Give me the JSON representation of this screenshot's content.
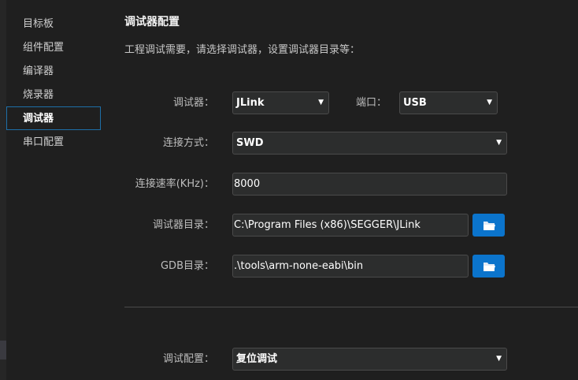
{
  "sidebar": {
    "items": [
      {
        "label": "目标板"
      },
      {
        "label": "组件配置"
      },
      {
        "label": "编译器"
      },
      {
        "label": "烧录器"
      },
      {
        "label": "调试器",
        "active": true
      },
      {
        "label": "串口配置"
      }
    ]
  },
  "header": {
    "title": "调试器配置",
    "description": "工程调试需要，请选择调试器，设置调试器目录等："
  },
  "form": {
    "debugger": {
      "label": "调试器：",
      "value": "JLink"
    },
    "port": {
      "label": "端口：",
      "value": "USB"
    },
    "connection": {
      "label": "连接方式：",
      "value": "SWD"
    },
    "speed": {
      "label": "连接速率(KHz)：",
      "value": "8000"
    },
    "debugger_dir": {
      "label": "调试器目录：",
      "value": "C:\\Program Files (x86)\\SEGGER\\JLink"
    },
    "gdb_dir": {
      "label": "GDB目录：",
      "value": ".\\tools\\arm-none-eabi\\bin"
    },
    "debug_config": {
      "label": "调试配置：",
      "value": "复位调试"
    }
  },
  "colors": {
    "accent": "#0b74cc",
    "selection_border": "#1e6fa8"
  }
}
